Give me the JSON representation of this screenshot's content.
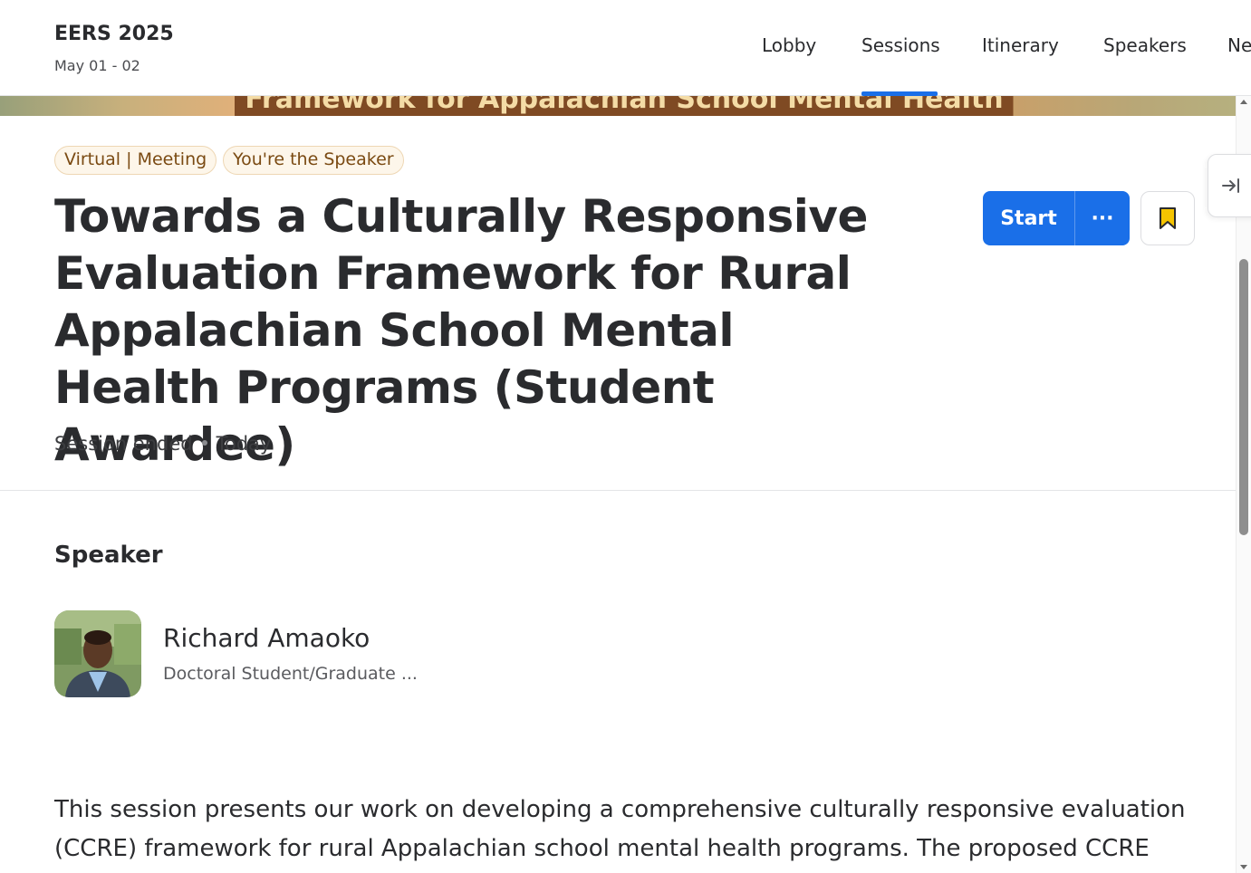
{
  "event": {
    "title": "EERS 2025",
    "dates": "May 01 - 02"
  },
  "nav": {
    "items": [
      "Lobby",
      "Sessions",
      "Itinerary",
      "Speakers",
      "Ne"
    ],
    "active": "Sessions"
  },
  "banner": {
    "text": "Framework for Appalachian School Mental Health"
  },
  "session": {
    "tags": [
      "Virtual | Meeting",
      "You're the Speaker"
    ],
    "title": "Towards a Culturally Responsive Evaluation Framework for Rural Appalachian School Mental Health Programs (Student Awardee)",
    "status": "Session ended",
    "when": "Today",
    "start_label": "Start",
    "more_label": "···"
  },
  "speaker_section": {
    "heading": "Speaker",
    "name": "Richard Amaoko",
    "role": "Doctoral Student/Graduate ..."
  },
  "description": "This session presents our work on developing a comprehensive culturally responsive evaluation (CCRE) framework for rural Appalachian school mental health programs. The proposed CCRE",
  "colors": {
    "accent": "#1a6fe8",
    "bookmark": "#f5c400",
    "tag_bg": "#fdf6ea",
    "tag_text": "#7a4a12"
  },
  "icons": {
    "more": "ellipsis-icon",
    "bookmark": "bookmark-icon",
    "side_tab": "collapse-right-icon"
  }
}
